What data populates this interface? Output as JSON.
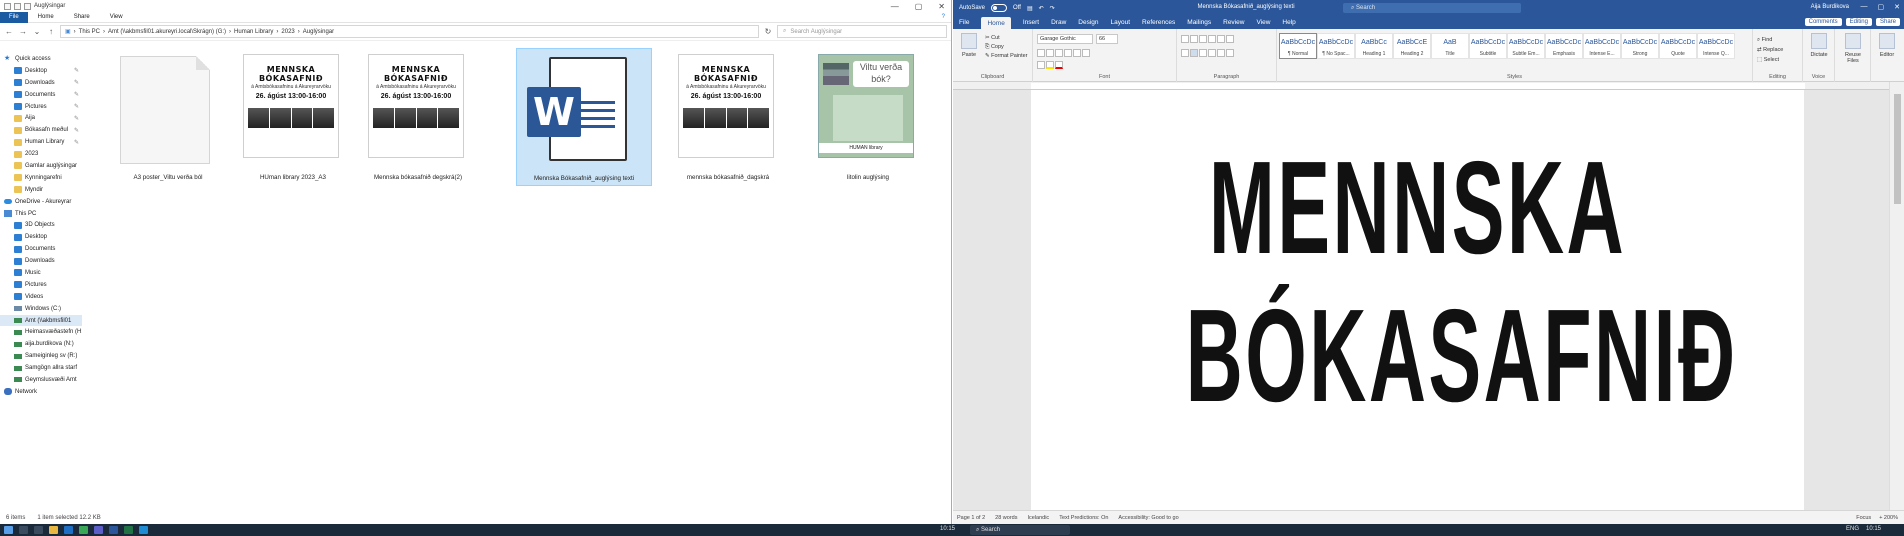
{
  "explorer": {
    "title": "Auglýsingar",
    "window_controls": [
      "—",
      "▢",
      "✕"
    ],
    "ribbon": {
      "file": "File",
      "tabs": [
        "Home",
        "Share",
        "View"
      ]
    },
    "address": [
      "This PC",
      "Amt (\\\\akbmsfil01.akureyri.local\\Skrágn) (G:)",
      "Human Library",
      "2023",
      "Auglýsingar"
    ],
    "search_placeholder": "Search Auglýsingar",
    "nav": [
      {
        "label": "Quick access",
        "icon": "star",
        "indent": 0,
        "pin": false
      },
      {
        "label": "Desktop",
        "icon": "blue",
        "indent": 1,
        "pin": true
      },
      {
        "label": "Downloads",
        "icon": "blue",
        "indent": 1,
        "pin": true
      },
      {
        "label": "Documents",
        "icon": "blue",
        "indent": 1,
        "pin": true
      },
      {
        "label": "Pictures",
        "icon": "blue",
        "indent": 1,
        "pin": true
      },
      {
        "label": "Aija",
        "icon": "fold",
        "indent": 1,
        "pin": true
      },
      {
        "label": "Bókasafn meðul",
        "icon": "fold",
        "indent": 1,
        "pin": true
      },
      {
        "label": "Human Library",
        "icon": "fold",
        "indent": 1,
        "pin": true
      },
      {
        "label": "2023",
        "icon": "fold",
        "indent": 1,
        "pin": false
      },
      {
        "label": "Gamlar auglýsingar",
        "icon": "fold",
        "indent": 1,
        "pin": false
      },
      {
        "label": "Kynningarefni",
        "icon": "fold",
        "indent": 1,
        "pin": false
      },
      {
        "label": "Myndir",
        "icon": "fold",
        "indent": 1,
        "pin": false
      },
      {
        "label": "OneDrive - Akureyrar",
        "icon": "cloud",
        "indent": 0,
        "pin": false
      },
      {
        "label": "This PC",
        "icon": "pc",
        "indent": 0,
        "pin": false
      },
      {
        "label": "3D Objects",
        "icon": "blue",
        "indent": 1,
        "pin": false
      },
      {
        "label": "Desktop",
        "icon": "blue",
        "indent": 1,
        "pin": false
      },
      {
        "label": "Documents",
        "icon": "blue",
        "indent": 1,
        "pin": false
      },
      {
        "label": "Downloads",
        "icon": "blue",
        "indent": 1,
        "pin": false
      },
      {
        "label": "Music",
        "icon": "blue",
        "indent": 1,
        "pin": false
      },
      {
        "label": "Pictures",
        "icon": "blue",
        "indent": 1,
        "pin": false
      },
      {
        "label": "Videos",
        "icon": "blue",
        "indent": 1,
        "pin": false
      },
      {
        "label": "Windows (C:)",
        "icon": "drv",
        "indent": 1,
        "pin": false
      },
      {
        "label": "Amt (\\\\akbmsfil01",
        "icon": "grn",
        "indent": 1,
        "pin": false,
        "selected": true
      },
      {
        "label": "Heimasvæðastefn (H:",
        "icon": "grn",
        "indent": 1,
        "pin": false
      },
      {
        "label": "aija.burdikova (N:)",
        "icon": "grn",
        "indent": 1,
        "pin": false
      },
      {
        "label": "Sameiginleg sv (R:)",
        "icon": "grn",
        "indent": 1,
        "pin": false
      },
      {
        "label": "Samgögn allra starf",
        "icon": "grn",
        "indent": 1,
        "pin": false
      },
      {
        "label": "Geymslusvæði Amt",
        "icon": "grn",
        "indent": 1,
        "pin": false
      },
      {
        "label": "Network",
        "icon": "net",
        "indent": 0,
        "pin": false
      }
    ],
    "files": [
      {
        "label": "A3 poster_Viltu verða ból",
        "kind": "blank"
      },
      {
        "label": "HUman library 2023_A3",
        "kind": "poster"
      },
      {
        "label": "Mennska bókasafnið degskrá(2)",
        "kind": "poster"
      },
      {
        "label": "Mennska Bókasafnið_auglýsing texti",
        "kind": "word",
        "selected": true
      },
      {
        "label": "mennska bókasafnið_dagskrá",
        "kind": "poster"
      },
      {
        "label": "litolin auglýsing",
        "kind": "green"
      }
    ],
    "poster": {
      "title": "MENNSKA BÓKASAFNIÐ",
      "subtitle": "á Amtsbókasafninu á Akureyrarvöku",
      "date": "26. ágúst 13:00-16:00"
    },
    "green_poster": {
      "question": "Viltu verða bók?",
      "footer": "HUMAN library"
    },
    "status": {
      "items": "6 items",
      "selected": "1 item selected  12.2 KB"
    }
  },
  "word": {
    "autosave": "AutoSave",
    "autosave_state": "Off",
    "doc_title": "Mennska Bókasafnið_auglýsing texti",
    "search": "Search",
    "user": "Aija Burdikova",
    "tabs": [
      "File",
      "Home",
      "Insert",
      "Draw",
      "Design",
      "Layout",
      "References",
      "Mailings",
      "Review",
      "View",
      "Help"
    ],
    "active_tab": "Home",
    "right_buttons": [
      "Comments",
      "Editing",
      "Share"
    ],
    "clipboard": {
      "paste": "Paste",
      "cut": "Cut",
      "copy": "Copy",
      "format": "Format Painter",
      "label": "Clipboard"
    },
    "font": {
      "name": "Garage Gothic",
      "size": "66",
      "label": "Font"
    },
    "paragraph_label": "Paragraph",
    "styles": [
      {
        "prev": "AaBbCcDc",
        "name": "¶ Normal",
        "sel": true
      },
      {
        "prev": "AaBbCcDc",
        "name": "¶ No Spac..."
      },
      {
        "prev": "AaBbCc",
        "name": "Heading 1"
      },
      {
        "prev": "AaBbCcE",
        "name": "Heading 2"
      },
      {
        "prev": "AaB",
        "name": "Title"
      },
      {
        "prev": "AaBbCcDc",
        "name": "Subtitle"
      },
      {
        "prev": "AaBbCcDc",
        "name": "Subtle Em..."
      },
      {
        "prev": "AaBbCcDc",
        "name": "Emphasis"
      },
      {
        "prev": "AaBbCcDc",
        "name": "Intense E..."
      },
      {
        "prev": "AaBbCcDc",
        "name": "Strong"
      },
      {
        "prev": "AaBbCcDc",
        "name": "Quote"
      },
      {
        "prev": "AaBbCcDc",
        "name": "Intense Q..."
      }
    ],
    "styles_label": "Styles",
    "editing": {
      "find": "Find",
      "replace": "Replace",
      "select": "Select",
      "label": "Editing"
    },
    "dictate": "Dictate",
    "voice": "Voice",
    "reuse": "Reuse Files",
    "reuse_label": "Reuse Files",
    "editor": "Editor",
    "document_lines": [
      "MENNSKA",
      "BÓKASAFNIÐ"
    ],
    "status": {
      "page": "Page 1 of 2",
      "words": "28 words",
      "lang": "Icelandic",
      "predictions": "Text Predictions: On",
      "access": "Accessibility: Good to go",
      "focus": "Focus",
      "zoom": "+ 200%"
    }
  },
  "taskbar": {
    "search": "Search",
    "time_left": "10:15",
    "time_right": "10:15",
    "lang": "ENG"
  }
}
